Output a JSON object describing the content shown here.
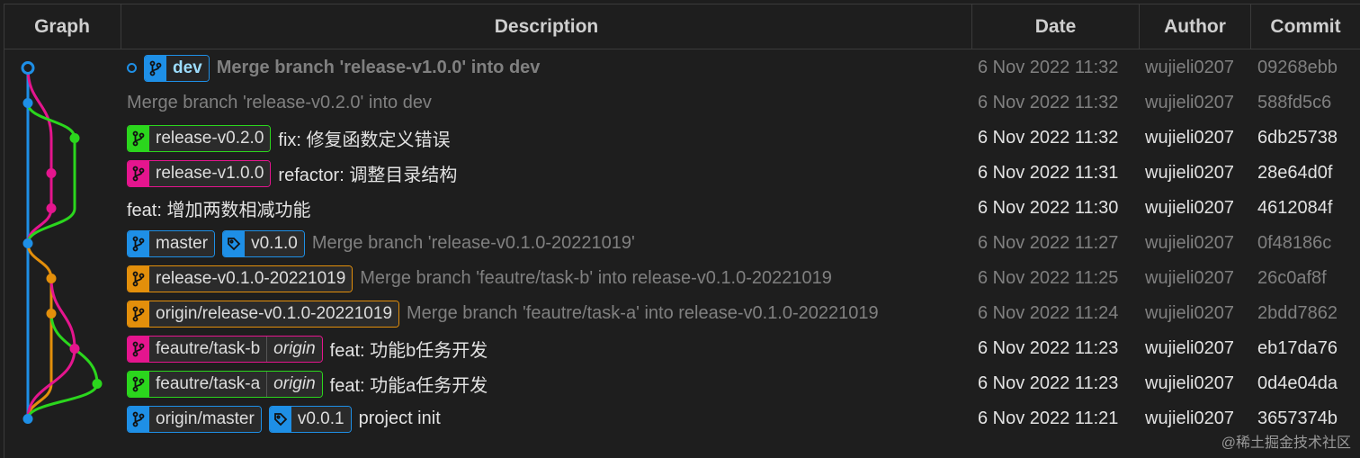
{
  "columns": {
    "graph": "Graph",
    "description": "Description",
    "date": "Date",
    "author": "Author",
    "commit": "Commit"
  },
  "colors": {
    "blue": "#1e8fe6",
    "magenta": "#e5158e",
    "green": "#2bd61d",
    "orange": "#e38f0b"
  },
  "commits": [
    {
      "message": "Merge branch 'release-v1.0.0' into dev",
      "date": "6 Nov 2022 11:32",
      "author": "wujieli0207",
      "hash": "09268ebb",
      "style": "dim bold",
      "head": true,
      "refs": [
        {
          "type": "branch",
          "label": "dev",
          "color": "blue",
          "current": true
        }
      ]
    },
    {
      "message": "Merge branch 'release-v0.2.0' into dev",
      "date": "6 Nov 2022 11:32",
      "author": "wujieli0207",
      "hash": "588fd5c6",
      "style": "dim",
      "refs": []
    },
    {
      "message": "fix: 修复函数定义错误",
      "date": "6 Nov 2022 11:32",
      "author": "wujieli0207",
      "hash": "6db25738",
      "style": "normal",
      "refs": [
        {
          "type": "branch",
          "label": "release-v0.2.0",
          "color": "green"
        }
      ]
    },
    {
      "message": "refactor: 调整目录结构",
      "date": "6 Nov 2022 11:31",
      "author": "wujieli0207",
      "hash": "28e64d0f",
      "style": "normal",
      "refs": [
        {
          "type": "branch",
          "label": "release-v1.0.0",
          "color": "magenta"
        }
      ]
    },
    {
      "message": "feat: 增加两数相减功能",
      "date": "6 Nov 2022 11:30",
      "author": "wujieli0207",
      "hash": "4612084f",
      "style": "normal",
      "refs": []
    },
    {
      "message": "Merge branch 'release-v0.1.0-20221019'",
      "date": "6 Nov 2022 11:27",
      "author": "wujieli0207",
      "hash": "0f48186c",
      "style": "dim",
      "refs": [
        {
          "type": "branch",
          "label": "master",
          "color": "blue"
        },
        {
          "type": "tag",
          "label": "v0.1.0",
          "color": "blue"
        }
      ]
    },
    {
      "message": "Merge branch 'feautre/task-b' into release-v0.1.0-20221019",
      "date": "6 Nov 2022 11:25",
      "author": "wujieli0207",
      "hash": "26c0af8f",
      "style": "dim",
      "refs": [
        {
          "type": "branch",
          "label": "release-v0.1.0-20221019",
          "color": "orange"
        }
      ]
    },
    {
      "message": "Merge branch 'feautre/task-a' into release-v0.1.0-20221019",
      "date": "6 Nov 2022 11:24",
      "author": "wujieli0207",
      "hash": "2bdd7862",
      "style": "dim",
      "refs": [
        {
          "type": "branch",
          "label": "origin/release-v0.1.0-20221019",
          "color": "orange"
        }
      ]
    },
    {
      "message": "feat: 功能b任务开发",
      "date": "6 Nov 2022 11:23",
      "author": "wujieli0207",
      "hash": "eb17da76",
      "style": "normal",
      "refs": [
        {
          "type": "branch",
          "label": "feautre/task-b",
          "color": "magenta",
          "suffix": "origin"
        }
      ]
    },
    {
      "message": "feat: 功能a任务开发",
      "date": "6 Nov 2022 11:23",
      "author": "wujieli0207",
      "hash": "0d4e04da",
      "style": "normal",
      "refs": [
        {
          "type": "branch",
          "label": "feautre/task-a",
          "color": "green",
          "suffix": "origin"
        }
      ]
    },
    {
      "message": "project init",
      "date": "6 Nov 2022 11:21",
      "author": "wujieli0207",
      "hash": "3657374b",
      "style": "normal",
      "refs": [
        {
          "type": "branch",
          "label": "origin/master",
          "color": "blue"
        },
        {
          "type": "tag",
          "label": "v0.0.1",
          "color": "blue"
        }
      ]
    }
  ],
  "watermark": "@稀土掘金技术社区"
}
